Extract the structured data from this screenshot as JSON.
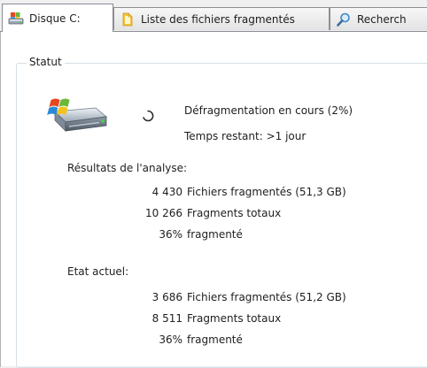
{
  "tabs": [
    {
      "label": "Disque C:",
      "icon": "drive-icon",
      "active": true
    },
    {
      "label": "Liste des fichiers fragmentés",
      "icon": "folder-icon",
      "active": false
    },
    {
      "label": "Recherch",
      "icon": "search-icon",
      "active": false
    }
  ],
  "status": {
    "group_title": "Statut",
    "progress_text": "Défragmentation en cours (2%)",
    "time_remaining": "Temps restant: >1 jour"
  },
  "analysis": {
    "title": "Résultats de l'analyse:",
    "rows": [
      {
        "value": "4 430",
        "label": "Fichiers fragmentés (51,3 GB)"
      },
      {
        "value": "10 266",
        "label": "Fragments totaux"
      },
      {
        "value": "36%",
        "label": "fragmenté"
      }
    ]
  },
  "current": {
    "title": "Etat actuel:",
    "rows": [
      {
        "value": "3 686",
        "label": "Fichiers fragmentés (51,2 GB)"
      },
      {
        "value": "8 511",
        "label": "Fragments totaux"
      },
      {
        "value": "36%",
        "label": "fragmenté"
      }
    ]
  }
}
